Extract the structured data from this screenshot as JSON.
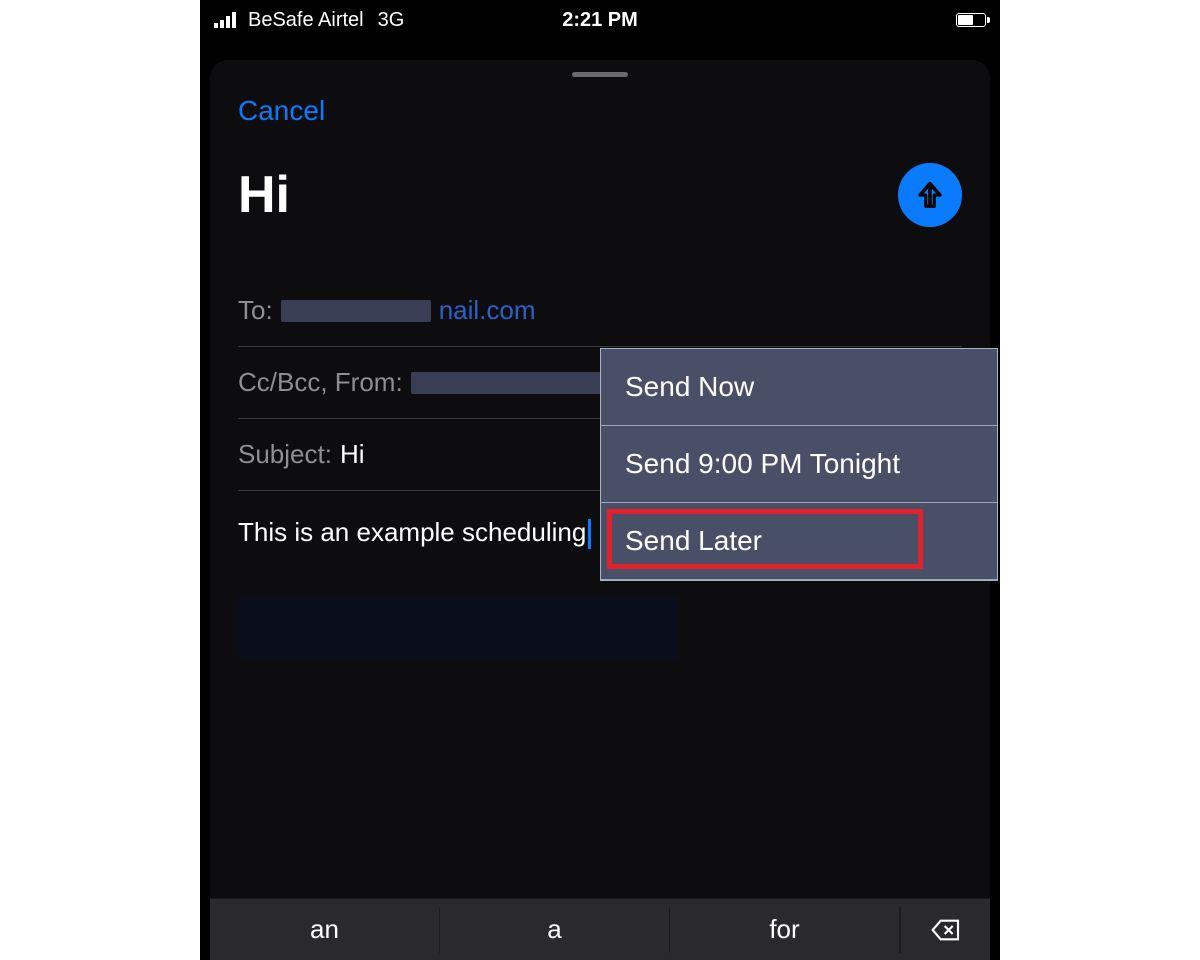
{
  "status": {
    "carrier": "BeSafe Airtel",
    "network": "3G",
    "time": "2:21 PM"
  },
  "compose": {
    "cancel": "Cancel",
    "subject_title": "Hi",
    "to_label": "To:",
    "to_suffix": "nail.com",
    "ccbcc_label": "Cc/Bcc, From:",
    "subject_label": "Subject:",
    "subject_value": "Hi",
    "body": "This is an example scheduling"
  },
  "menu": {
    "items": [
      "Send Now",
      "Send 9:00 PM Tonight",
      "Send Later"
    ]
  },
  "keyboard": {
    "suggestions": [
      "an",
      "a",
      "for"
    ]
  },
  "colors": {
    "accent": "#0a7bff",
    "menu_bg": "#4a4f68",
    "highlight": "#e3212a"
  }
}
